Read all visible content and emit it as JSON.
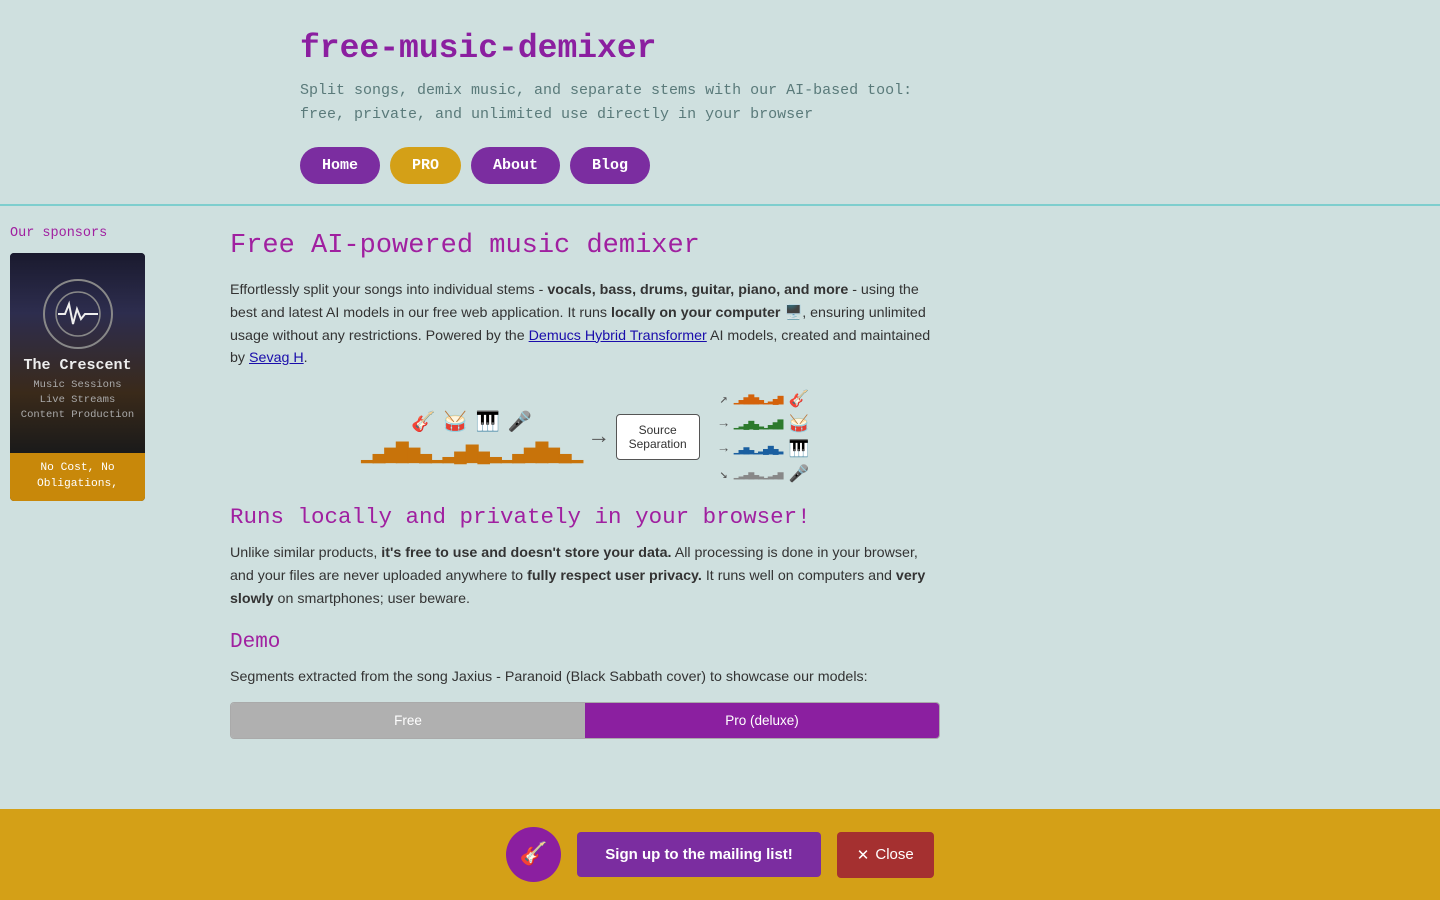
{
  "header": {
    "title": "free-music-demixer",
    "subtitle_line1": "Split songs, demix music, and separate stems with our AI-based tool:",
    "subtitle_line2": "free, private, and unlimited use directly in your browser",
    "nav": {
      "home": "Home",
      "pro": "PRO",
      "about": "About",
      "blog": "Blog"
    }
  },
  "sidebar": {
    "sponsors_label": "Our sponsors",
    "sponsor": {
      "name": "The Crescent",
      "line1": "Music Sessions",
      "line2": "Live Streams",
      "line3": "Content Production",
      "cta_line1": "No Cost, No",
      "cta_line2": "Obligations,"
    }
  },
  "content": {
    "main_title": "Free AI-powered music demixer",
    "intro_text_1a": "Effortlessly split your songs into individual stems - ",
    "intro_bold": "vocals, bass, drums, guitar, piano, and more",
    "intro_text_1b": " - using the best and latest AI models in our free web application. It runs ",
    "intro_bold2": "locally on your computer",
    "intro_emoji": "🖥️",
    "intro_text_1c": ", ensuring unlimited usage without any restrictions. Powered by the ",
    "intro_link1": "Demucs Hybrid Transformer",
    "intro_text_1d": " AI models, created and maintained by ",
    "intro_link2": "Sevag H",
    "intro_text_1e": ".",
    "section2_title": "Runs locally and privately in your browser!",
    "privacy_text_1a": "Unlike similar products, ",
    "privacy_bold1": "it's free to use and doesn't store your data.",
    "privacy_text_1b": " All processing is done in your browser, and your files are never uploaded anywhere to ",
    "privacy_bold2": "fully respect user privacy.",
    "privacy_text_1c": " It runs well on computers and ",
    "privacy_bold3": "very slowly",
    "privacy_text_1d": " on smartphones; user beware.",
    "demo_title": "Demo",
    "demo_text": "Segments extracted from the song Jaxius - Paranoid (Black Sabbath cover) to showcase our models:",
    "table": {
      "free_label": "Free",
      "pro_label": "Pro (deluxe)"
    }
  },
  "mailing": {
    "icon": "🎸",
    "btn_label": "Sign up to the mailing list!",
    "close_label": "Close",
    "close_x": "✕"
  }
}
